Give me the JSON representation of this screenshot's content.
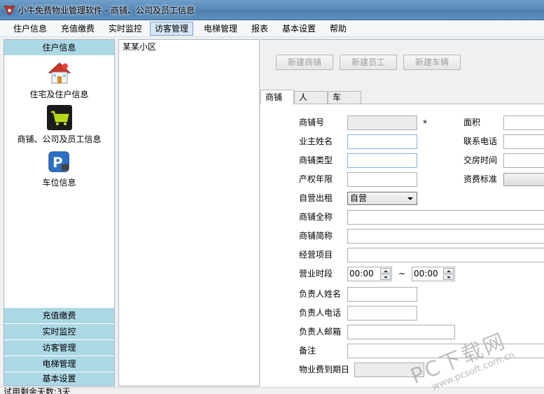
{
  "window": {
    "title": "小牛免费物业管理软件 - 商铺、公司及员工信息"
  },
  "menu": {
    "items": [
      "住户信息",
      "充值缴费",
      "实时监控",
      "访客管理",
      "电梯管理",
      "报表",
      "基本设置",
      "帮助"
    ],
    "active": "访客管理"
  },
  "left_nav": {
    "top_group": "住户信息",
    "entries": [
      {
        "label": "住宅及住户信息",
        "icon": "house-icon"
      },
      {
        "label": "商铺、公司及员工信息",
        "icon": "shopping-cart-icon"
      },
      {
        "label": "车位信息",
        "icon": "parking-icon"
      }
    ],
    "bottom_groups": [
      "充值缴费",
      "实时监控",
      "访客管理",
      "电梯管理",
      "基本设置"
    ]
  },
  "tree": {
    "root": "某某小区"
  },
  "toolbar": {
    "new_shop": "新建商铺",
    "new_staff": "新建员工",
    "new_vehicle": "新建车辆"
  },
  "tabs": [
    "商铺",
    "人",
    "车"
  ],
  "form": {
    "shop_no": "商铺号",
    "required_mark": "*",
    "area": "面积",
    "owner_name": "业主姓名",
    "phone": "联系电话",
    "shop_type": "商铺类型",
    "handover_time": "交房时间",
    "property_years": "产权年限",
    "fee_standard": "资费标准",
    "self_rent": "自营出租",
    "self_rent_value": "自营",
    "full_name": "商铺全称",
    "short_name": "商铺简称",
    "business": "经营项目",
    "hours": "营业时段",
    "hours_start": "00:00",
    "hours_sep": "~",
    "hours_end": "00:00",
    "manager_name": "负责人姓名",
    "manager_phone": "负责人电话",
    "manager_email": "负责人邮箱",
    "remark": "备注",
    "fee_due": "物业费到期日"
  },
  "status": {
    "text": "试用剩余天数:3天"
  },
  "watermark": {
    "main": "PC下载网",
    "url": "www.pcsoft.com.cn"
  },
  "colors": {
    "nav_header": "#acd8e6",
    "title_bar": "#5a8bb8"
  }
}
